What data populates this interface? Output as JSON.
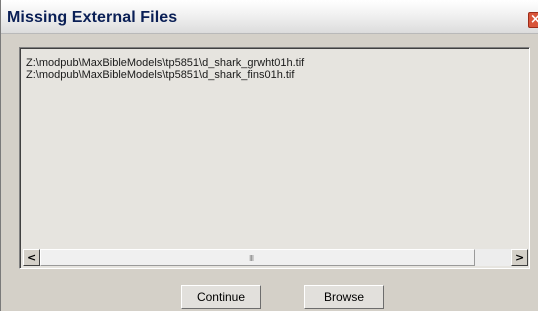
{
  "dialog": {
    "title": "Missing External Files"
  },
  "files": [
    "Z:\\modpub\\MaxBibleModels\\tp5851\\d_shark_grwht01h.tif",
    "Z:\\modpub\\MaxBibleModels\\tp5851\\d_shark_fins01h.tif"
  ],
  "scrollbar": {
    "grip": "III",
    "left_arrow": "<",
    "right_arrow": ">"
  },
  "buttons": {
    "continue_label": "Continue",
    "browse_label": "Browse"
  },
  "close_glyph": "×",
  "colors": {
    "title_text": "#0a1f56",
    "close_button": "#d8553a",
    "dialog_face": "#d4d0c8",
    "list_background": "#e6e4df"
  }
}
